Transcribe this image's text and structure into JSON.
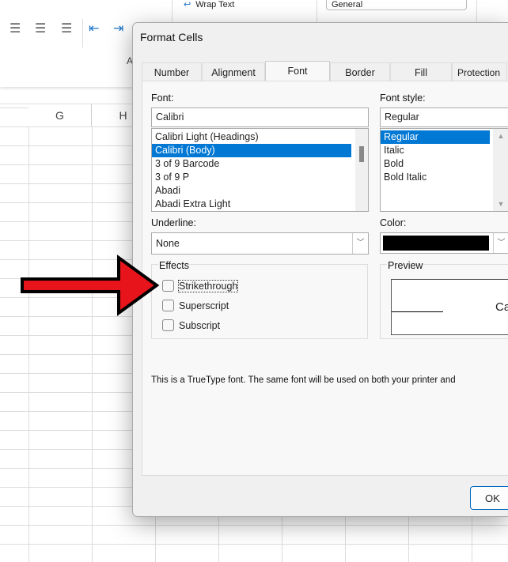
{
  "spreadsheet": {
    "columns": [
      "G",
      "H"
    ]
  },
  "ribbon": {
    "group_label_fragment": "A",
    "wrap_text": "Wrap Text",
    "number_format": "General"
  },
  "dialog": {
    "title": "Format Cells",
    "tabs": [
      {
        "label": "Number"
      },
      {
        "label": "Alignment"
      },
      {
        "label": "Font",
        "active": true
      },
      {
        "label": "Border"
      },
      {
        "label": "Fill"
      },
      {
        "label": "Protection"
      }
    ],
    "font": {
      "label": "Font:",
      "value": "Calibri",
      "list": [
        "Calibri Light (Headings)",
        "Calibri (Body)",
        "3 of 9 Barcode",
        "3 of 9 P",
        "Abadi",
        "Abadi Extra Light"
      ],
      "selected": "Calibri (Body)"
    },
    "font_style": {
      "label": "Font style:",
      "value": "Regular",
      "list": [
        "Regular",
        "Italic",
        "Bold",
        "Bold Italic"
      ],
      "selected": "Regular"
    },
    "underline": {
      "label": "Underline:",
      "value": "None"
    },
    "color": {
      "label": "Color:",
      "value": "#000000"
    },
    "effects": {
      "label": "Effects",
      "items": [
        {
          "label": "Strikethrough",
          "checked": false,
          "focused": true
        },
        {
          "label": "Superscript",
          "checked": false
        },
        {
          "label": "Subscript",
          "checked": false
        }
      ]
    },
    "preview": {
      "label": "Preview",
      "sample": "Ca"
    },
    "info": "This is a TrueType font.  The same font will be used on both your printer and",
    "ok_button": "OK"
  },
  "annotation": {
    "arrow_color": "#e8141b"
  }
}
